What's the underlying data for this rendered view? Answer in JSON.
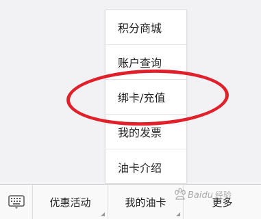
{
  "popup_menu": {
    "items": [
      {
        "label": "积分商城"
      },
      {
        "label": "账户查询"
      },
      {
        "label": "绑卡/充值"
      },
      {
        "label": "我的发票"
      },
      {
        "label": "油卡介绍"
      }
    ]
  },
  "bottom_bar": {
    "keyboard_icon": "keyboard-icon",
    "items": [
      {
        "label": "优惠活动"
      },
      {
        "label": "我的油卡"
      },
      {
        "label": "更多"
      }
    ]
  },
  "watermark": {
    "text": "Baidu经验"
  },
  "colors": {
    "annotation": "#e0202b",
    "background": "#f2f2f4",
    "menu_background": "#ffffff",
    "text": "#222222"
  }
}
